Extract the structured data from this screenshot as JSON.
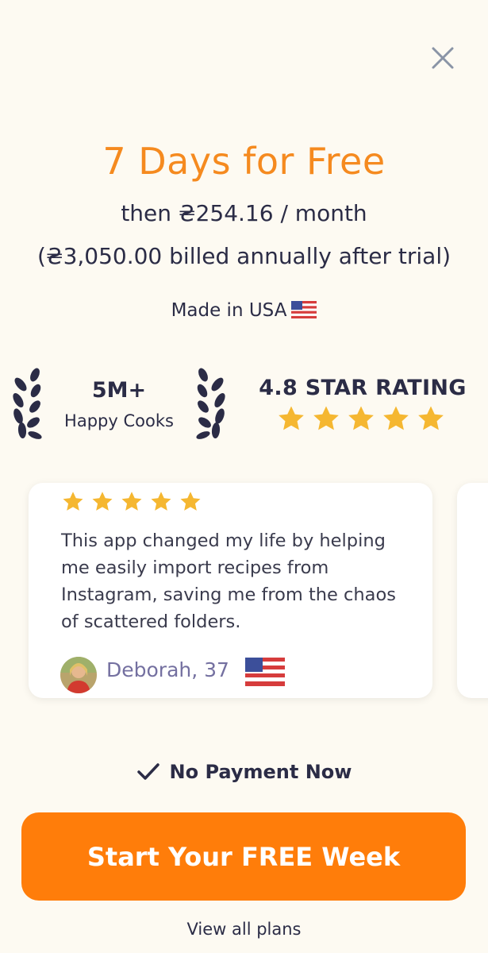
{
  "close_icon": "close-icon",
  "offer": {
    "headline": "7 Days for Free",
    "price_line": "then ₴254.16 / month",
    "billing_line": "(₴3,050.00 billed annually after trial)",
    "made_in": "Made in USA"
  },
  "stats": {
    "users_count": "5M+",
    "users_label": "Happy Cooks",
    "rating_title": "4.8 STAR RATING",
    "rating_stars": 5
  },
  "testimonial": {
    "stars": 5,
    "text": "This app changed my life by helping me easily import recipes from Instagram, saving me from the chaos of scattered folders.",
    "reviewer": "Deborah, 37",
    "reviewer_flag": "us-flag-icon"
  },
  "footer": {
    "no_payment": "No Payment Now",
    "cta_label": "Start Your FREE Week",
    "view_plans": "View all plans"
  },
  "colors": {
    "background": "#fdfaf2",
    "accent_orange": "#ff7d0a",
    "headline_orange": "#f58a1f",
    "text_dark": "#2b2c46",
    "star_gold": "#f5b731"
  }
}
